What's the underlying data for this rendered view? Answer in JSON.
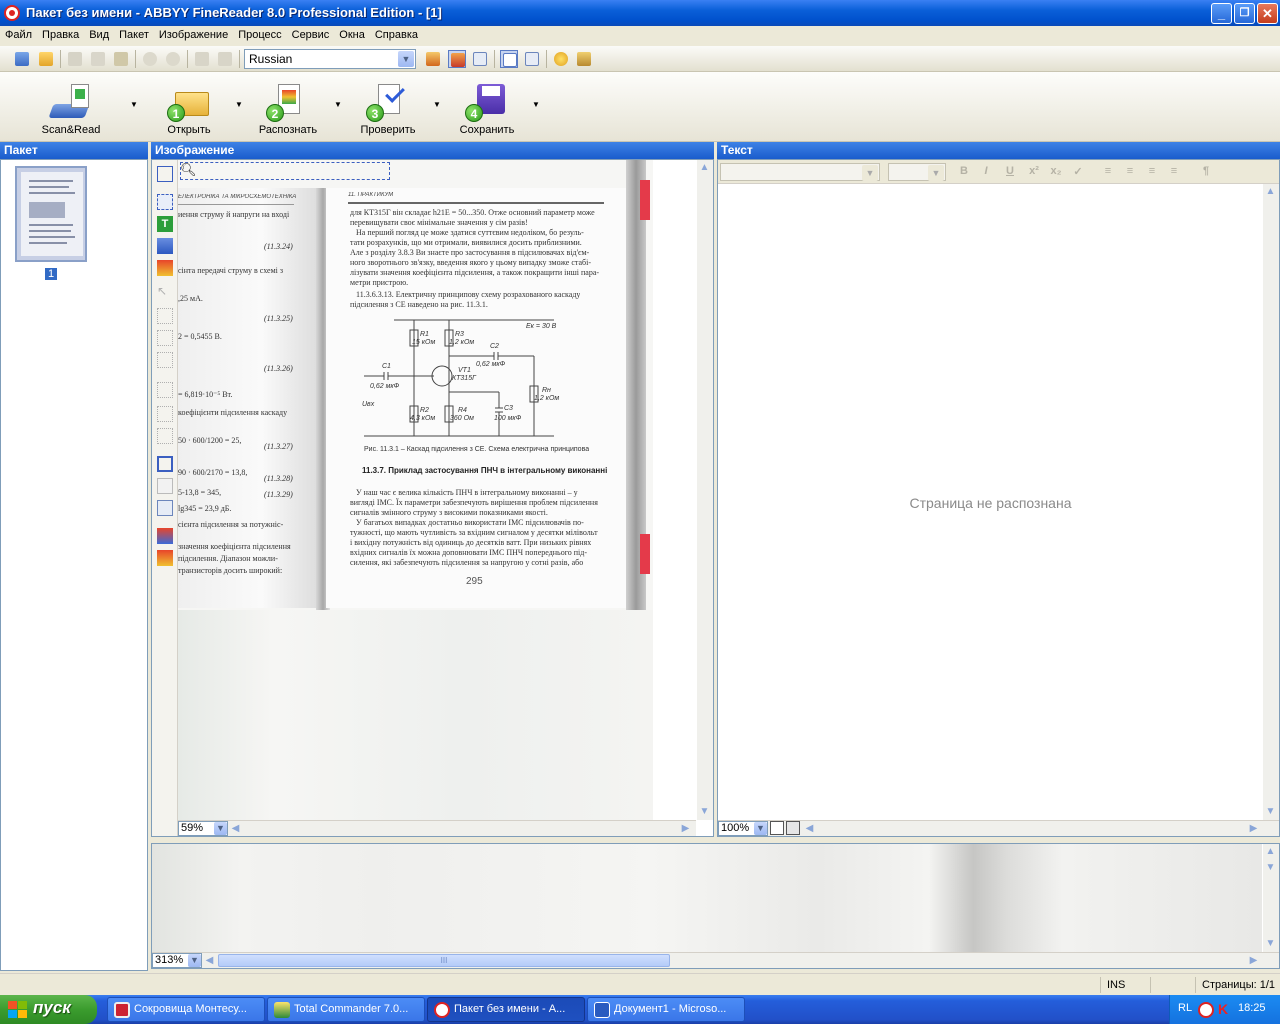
{
  "window": {
    "title": "Пакет без имени - ABBYY FineReader 8.0 Professional Edition - [1]",
    "controls": {
      "minimize": "_",
      "maximize": "❐",
      "close": "✕"
    }
  },
  "menu": [
    "Файл",
    "Правка",
    "Вид",
    "Пакет",
    "Изображение",
    "Процесс",
    "Сервис",
    "Окна",
    "Справка"
  ],
  "toolbar": {
    "language": "Russian"
  },
  "big_toolbar": {
    "scan_read": "Scan&Read",
    "open": {
      "label": "Открыть",
      "step": "1"
    },
    "recognize": {
      "label": "Распознать",
      "step": "2"
    },
    "check": {
      "label": "Проверить",
      "step": "3"
    },
    "save": {
      "label": "Сохранить",
      "step": "4"
    }
  },
  "panels": {
    "package": {
      "title": "Пакет",
      "page_number": "1"
    },
    "image": {
      "title": "Изображение",
      "zoom": "59%"
    },
    "text": {
      "title": "Текст",
      "zoom": "100%",
      "message": "Страница не распознана"
    },
    "zoom_window": {
      "zoom": "313%",
      "thumb_grip": "III"
    }
  },
  "scan_page": {
    "left_header": "ЕЛЕКТРОНІКА ТА МІКРОСХЕМОТЕХНІКА",
    "left_lines": [
      "иення струму й напруги на вході",
      "(11.3.24)",
      "сінта передачі струму в схемі з",
      ",25 мА.",
      "(11.3.25)",
      "2 = 0,5455 В.",
      "(11.3.26)",
      "= 6,819·10⁻⁵ Вт.",
      "коефіцієнти підсилення каскаду",
      "50 · 600/1200 = 25,",
      "(11.3.27)",
      "90 · 600/2170 = 13,8,",
      "(11.3.28)",
      "5-13,8 = 345,",
      "(11.3.29)",
      "lg345 = 23,9 дБ.",
      "сієнта підсилення за потужніс-",
      "значення коефіцієнта підсилення",
      "підсилення. Діапазон можли-",
      "транзисторів досить широкий:"
    ],
    "right_header": "11. ПРАКТИКУМ",
    "right_lines": [
      "для КТ315Г він складає h21Е = 50...350. Отже основний параметр може",
      "перевищувати своє мінімальне значення у сім разів!",
      "На перший погляд це може здатися суттєвим недоліком, бо резуль-",
      "тати розрахунків, що ми отримали, виявилися досить приблизними.",
      "Але з розділу 3.8.3 Ви знаєте про застосування в підсилювачах від'єм-",
      "ного зворотнього зв'язку, введення якого у цьому випадку зможе стабі-",
      "лізувати значення коефіцієнта підсилення, а також покращити інші пара-",
      "метри пристрою.",
      "11.3.6.3.13. Електричну принципову схему розрахованого каскаду",
      "підсилення з СЕ наведено на рис. 11.3.1."
    ],
    "circuit_labels": [
      "R1",
      "15 кОм",
      "R3",
      "1,2 кОм",
      "Eк = 30 В",
      "C2",
      "0,62 мкФ",
      "C1",
      "0,62 мкФ",
      "VT1",
      "КТ315Г",
      "Rн",
      "1,2 кОм",
      "Uвх",
      "R2",
      "4,3 кОм",
      "R4",
      "360 Ом",
      "C3",
      "100 мкФ"
    ],
    "figure_caption": "Рис. 11.3.1 – Каскад підсилення з СЕ. Схема електрична принципова",
    "section_heading": "11.3.7. Приклад застосування ПНЧ в інтегральному виконанні",
    "right_lines_2": [
      "У наш час є велика кількість ПНЧ в інтегральному виконанні – у",
      "вигляді ІМС. Їх параметри забезпечують вирішення проблем підсилення",
      "сигналів змінного струму з високими показниками якості.",
      "У багатьох випадках достатньо використати ІМС підсилювачів по-",
      "тужності, що мають чутливість за вхідним сигналом у десятки мілівольт",
      "і вихідну потужність від одиниць до десятків ватт. При низьких рівнях",
      "вхідних сигналів їх можна доповнювати ІМС ПНЧ попереднього під-",
      "силення, які забезпечують підсилення за напругою у сотні разів, або"
    ],
    "page_number": "295"
  },
  "status": {
    "ins": "INS",
    "pages": "Страницы: 1/1"
  },
  "taskbar": {
    "start": "пуск",
    "tasks": [
      {
        "label": "Сокровища Монтесу...",
        "active": false
      },
      {
        "label": "Total Commander 7.0...",
        "active": false
      },
      {
        "label": "Пакет без имени - A...",
        "active": true
      },
      {
        "label": "Документ1 - Microso...",
        "active": false
      }
    ],
    "lang": "RL",
    "clock": "18:25"
  },
  "colors": {
    "titlebar": "#0050cc",
    "panel_header": "#1a5ccc",
    "taskbar": "#245edb",
    "start": "#3b9c2e"
  }
}
